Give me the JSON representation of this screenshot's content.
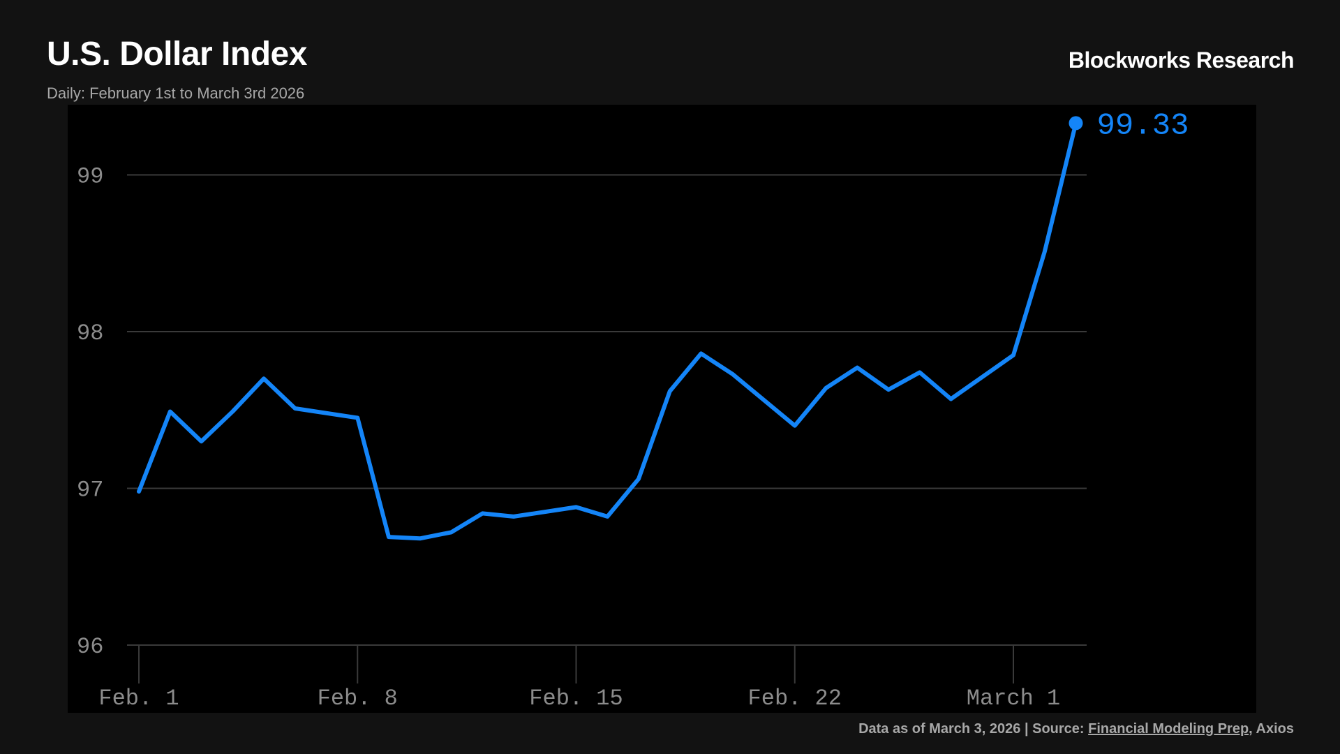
{
  "header": {
    "title": "U.S. Dollar Index",
    "subtitle": "Daily: February 1st to March 3rd 2026",
    "brand": "Blockworks Research"
  },
  "footer": {
    "prefix": "Data as of March 3, 2026 | Source: ",
    "source_link": "Financial Modeling Prep",
    "suffix": ", Axios"
  },
  "colors": {
    "background": "#121212",
    "plot_background": "#000000",
    "line": "#1485f8",
    "grid": "#3a3a3a",
    "tick_text": "#8c8c8c"
  },
  "chart_data": {
    "type": "line",
    "title": "U.S. Dollar Index",
    "subtitle": "Daily: February 1st to March 3rd 2026",
    "xlabel": "",
    "ylabel": "",
    "ylim": [
      96,
      99.33
    ],
    "yticks": [
      96,
      97,
      98,
      99
    ],
    "xticks": [
      {
        "date": "2026-02-01",
        "label": "Feb. 1"
      },
      {
        "date": "2026-02-08",
        "label": "Feb. 8"
      },
      {
        "date": "2026-02-15",
        "label": "Feb. 15"
      },
      {
        "date": "2026-02-22",
        "label": "Feb. 22"
      },
      {
        "date": "2026-03-01",
        "label": "March 1"
      }
    ],
    "grid": "horizontal",
    "legend": "none",
    "end_label": "99.33",
    "series": [
      {
        "points": [
          {
            "x": "2026-02-01",
            "y": 96.98
          },
          {
            "x": "2026-02-02",
            "y": 97.49
          },
          {
            "x": "2026-02-03",
            "y": 97.3
          },
          {
            "x": "2026-02-04",
            "y": 97.49
          },
          {
            "x": "2026-02-05",
            "y": 97.7
          },
          {
            "x": "2026-02-06",
            "y": 97.51
          },
          {
            "x": "2026-02-08",
            "y": 97.45
          },
          {
            "x": "2026-02-09",
            "y": 96.69
          },
          {
            "x": "2026-02-10",
            "y": 96.68
          },
          {
            "x": "2026-02-11",
            "y": 96.72
          },
          {
            "x": "2026-02-12",
            "y": 96.84
          },
          {
            "x": "2026-02-13",
            "y": 96.82
          },
          {
            "x": "2026-02-15",
            "y": 96.88
          },
          {
            "x": "2026-02-16",
            "y": 96.82
          },
          {
            "x": "2026-02-17",
            "y": 97.06
          },
          {
            "x": "2026-02-18",
            "y": 97.62
          },
          {
            "x": "2026-02-19",
            "y": 97.86
          },
          {
            "x": "2026-02-20",
            "y": 97.73
          },
          {
            "x": "2026-02-22",
            "y": 97.4
          },
          {
            "x": "2026-02-23",
            "y": 97.64
          },
          {
            "x": "2026-02-24",
            "y": 97.77
          },
          {
            "x": "2026-02-25",
            "y": 97.63
          },
          {
            "x": "2026-02-26",
            "y": 97.74
          },
          {
            "x": "2026-02-27",
            "y": 97.57
          },
          {
            "x": "2026-03-01",
            "y": 97.85
          },
          {
            "x": "2026-03-02",
            "y": 98.51
          },
          {
            "x": "2026-03-03",
            "y": 99.33
          }
        ]
      }
    ]
  }
}
